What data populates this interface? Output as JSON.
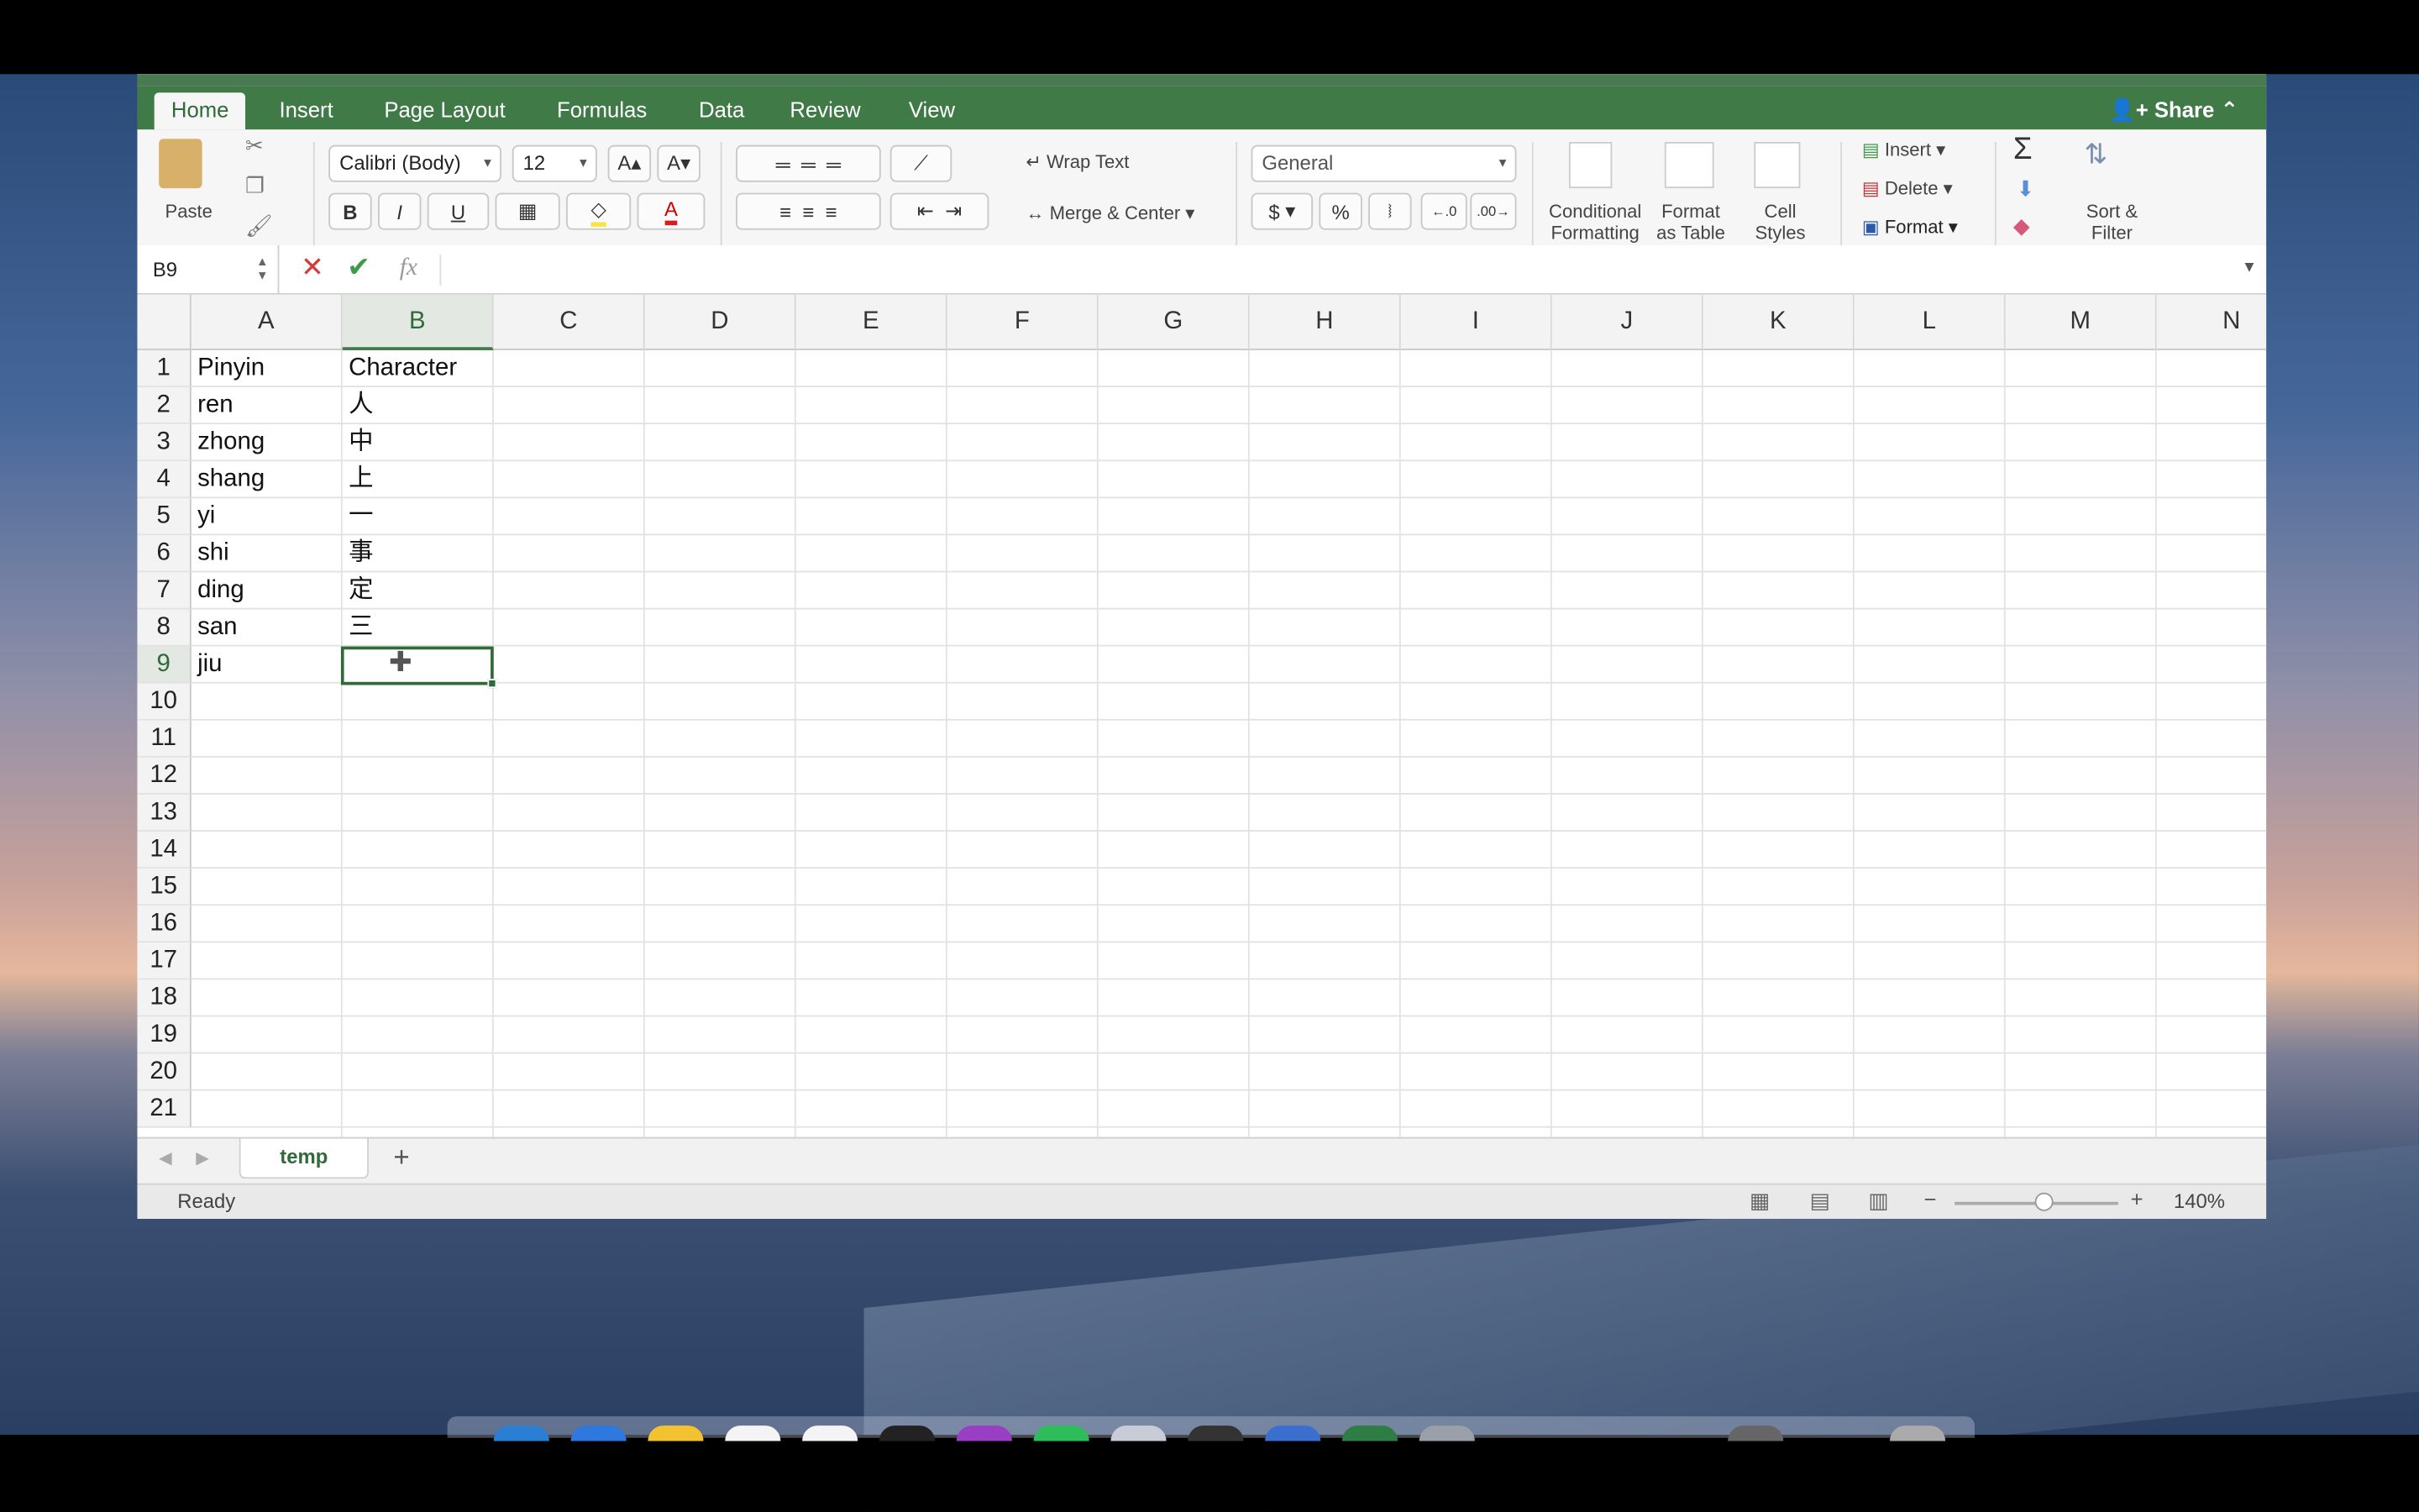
{
  "ribbon_tabs": [
    "Home",
    "Insert",
    "Page Layout",
    "Formulas",
    "Data",
    "Review",
    "View"
  ],
  "share_label": "Share",
  "clipboard": {
    "paste_label": "Paste"
  },
  "font": {
    "name": "Calibri (Body)",
    "size": "12",
    "bold": "B",
    "italic": "I",
    "underline": "U",
    "font_color_glyph": "A"
  },
  "alignment": {
    "wrap_text": "Wrap Text",
    "merge_center": "Merge & Center"
  },
  "number": {
    "format": "General",
    "currency": "$",
    "percent": "%"
  },
  "styles": {
    "conditional_1": "Conditional",
    "conditional_2": "Formatting",
    "format_table_1": "Format",
    "format_table_2": "as Table",
    "cell_styles_1": "Cell",
    "cell_styles_2": "Styles"
  },
  "cells_group": {
    "insert": "Insert",
    "delete": "Delete",
    "format": "Format"
  },
  "editing": {
    "sort_1": "Sort &",
    "sort_2": "Filter"
  },
  "formula_bar": {
    "name_box": "B9",
    "fx": "fx"
  },
  "columns": [
    "A",
    "B",
    "C",
    "D",
    "E",
    "F",
    "G",
    "H",
    "I",
    "J",
    "K",
    "L",
    "M",
    "N"
  ],
  "rows": [
    "1",
    "2",
    "3",
    "4",
    "5",
    "6",
    "7",
    "8",
    "9",
    "10",
    "11",
    "12",
    "13",
    "14",
    "15",
    "16",
    "17",
    "18",
    "19",
    "20",
    "21"
  ],
  "cells": {
    "a": [
      "Pinyin",
      "ren",
      "zhong",
      "shang",
      "yi",
      "shi",
      "ding",
      "san",
      "jiu"
    ],
    "b": [
      "Character",
      "人",
      "中",
      "上",
      "一",
      "事",
      "定",
      "三",
      ""
    ]
  },
  "selected_cell": "B9",
  "sheet_tabs": [
    "temp"
  ],
  "add_sheet": "+",
  "status": {
    "mode": "Ready",
    "zoom": "140%"
  },
  "colors": {
    "accent": "#3f7a47",
    "ribbon": "#f6f6f6"
  }
}
